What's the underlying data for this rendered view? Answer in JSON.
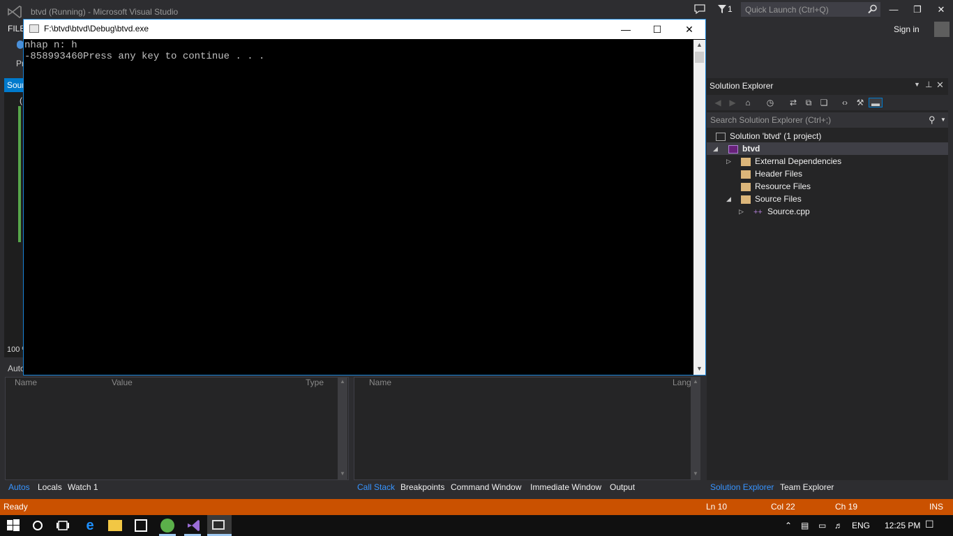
{
  "vs": {
    "title": "btvd (Running) - Microsoft Visual Studio",
    "notification_count": "1",
    "quick_launch_placeholder": "Quick Launch (Ctrl+Q)",
    "menu_file": "FILE",
    "sign_in": "Sign in",
    "toolbar_fragment": "Pr",
    "left_tab_fragment": "Sour",
    "left_paren": "(",
    "zoom_fragment": "100 %",
    "accent_color": "#007acc",
    "status_bar_color": "#ca5100"
  },
  "console": {
    "path": "F:\\btvd\\btvd\\Debug\\btvd.exe",
    "lines": [
      "nhap n: h",
      "-858993460Press any key to continue . . ."
    ]
  },
  "autos": {
    "title": "Autos",
    "columns": [
      "Name",
      "Value",
      "Type"
    ],
    "tabs": [
      "Autos",
      "Locals",
      "Watch 1"
    ]
  },
  "callstack": {
    "columns": [
      "Name",
      "Lang"
    ],
    "tabs": [
      "Call Stack",
      "Breakpoints",
      "Command Window",
      "Immediate Window",
      "Output"
    ]
  },
  "solution_explorer": {
    "title": "Solution Explorer",
    "search_placeholder": "Search Solution Explorer (Ctrl+;)",
    "tree": {
      "solution": "Solution 'btvd' (1 project)",
      "project": "btvd",
      "external": "External Dependencies",
      "headers": "Header Files",
      "resources": "Resource Files",
      "sources": "Source Files",
      "source_cpp": "Source.cpp"
    },
    "tabs": [
      "Solution Explorer",
      "Team Explorer"
    ]
  },
  "status": {
    "ready": "Ready",
    "line": "Ln 10",
    "col": "Col 22",
    "ch": "Ch 19",
    "mode": "INS"
  },
  "taskbar": {
    "language": "ENG",
    "time": "12:25 PM"
  }
}
